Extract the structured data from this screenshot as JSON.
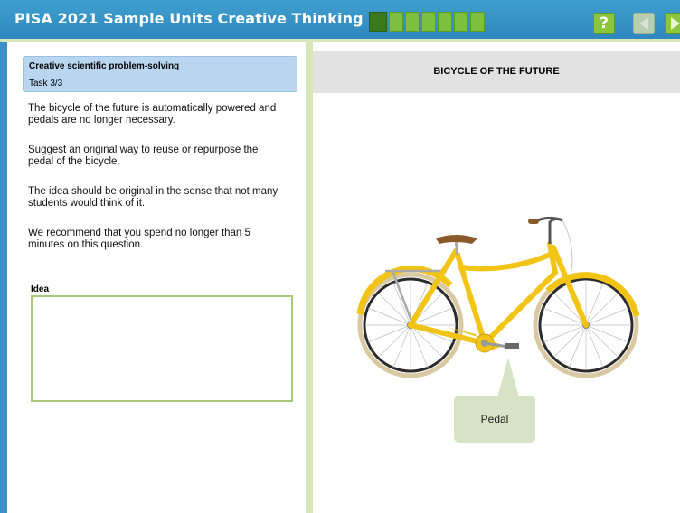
{
  "header": {
    "title": "PISA 2021 Sample Units Creative Thinking",
    "progress_total": 7,
    "progress_current": 1,
    "help_label": "?",
    "icons": {
      "help": "help-icon",
      "prev": "back-arrow-icon",
      "next": "next-arrow-icon"
    }
  },
  "task": {
    "title": "Creative scientific problem-solving",
    "number": "Task 3/3",
    "paragraphs": [
      "The bicycle of the future is automatically powered and pedals are no longer necessary.",
      "Suggest an original way to reuse or repurpose the pedal of the bicycle.",
      "The idea should be original in the sense that not many students would think of it.",
      "We recommend that you spend no longer than 5 minutes on this question."
    ],
    "idea_label": "Idea",
    "idea_value": ""
  },
  "figure": {
    "title": "BICYCLE OF THE FUTURE",
    "callout": "Pedal",
    "bike_color": "#f2c416"
  },
  "colors": {
    "topbar": "#3a95c9",
    "task_header": "#b9d6f1",
    "green": "#8cc63f",
    "callout": "#d7e3c4"
  }
}
